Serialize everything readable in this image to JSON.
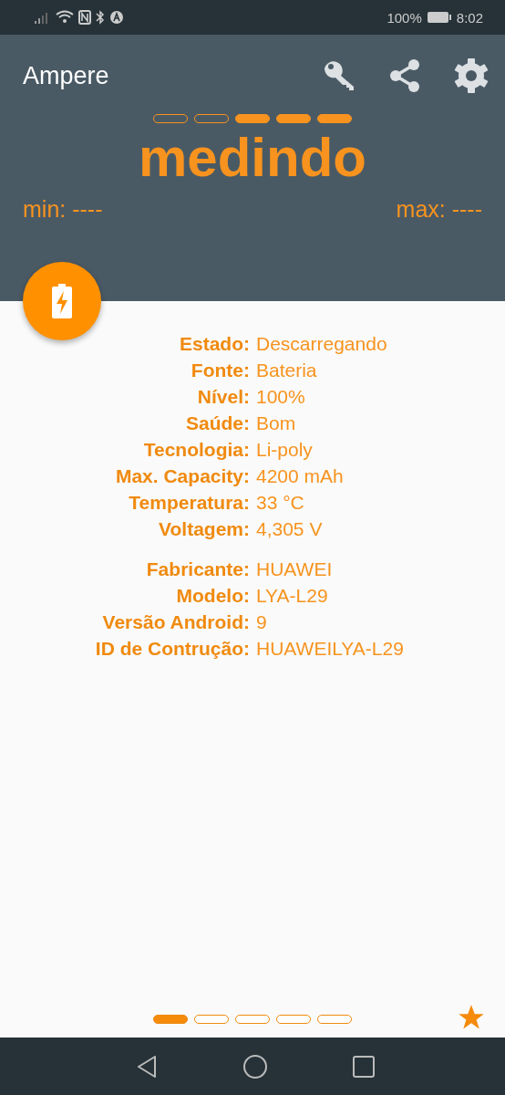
{
  "status_bar": {
    "battery": "100%",
    "time": "8:02"
  },
  "app_bar": {
    "title": "Ampere"
  },
  "meter": {
    "segments": [
      {
        "on": false
      },
      {
        "on": false
      },
      {
        "on": true
      },
      {
        "on": true
      },
      {
        "on": true
      }
    ],
    "reading": "medindo",
    "min": "min: ----",
    "max": "max: ----"
  },
  "info_groups": [
    {
      "rows": [
        {
          "label": "Estado:",
          "value": "Descarregando"
        },
        {
          "label": "Fonte:",
          "value": "Bateria"
        },
        {
          "label": "Nível:",
          "value": "100%"
        },
        {
          "label": "Saúde:",
          "value": "Bom"
        },
        {
          "label": "Tecnologia:",
          "value": "Li-poly"
        },
        {
          "label": "Max. Capacity:",
          "value": "4200 mAh"
        },
        {
          "label": "Temperatura:",
          "value": "33 °C"
        },
        {
          "label": "Voltagem:",
          "value": "4,305 V"
        }
      ]
    },
    {
      "rows": [
        {
          "label": "Fabricante:",
          "value": "HUAWEI"
        },
        {
          "label": "Modelo:",
          "value": "LYA-L29"
        },
        {
          "label": "Versão Android:",
          "value": "9"
        },
        {
          "label": "ID de Contrução:",
          "value": "HUAWEILYA-L29"
        }
      ]
    }
  ],
  "pages": [
    {
      "selected": true
    },
    {
      "selected": false
    },
    {
      "selected": false
    },
    {
      "selected": false
    },
    {
      "selected": false
    }
  ]
}
